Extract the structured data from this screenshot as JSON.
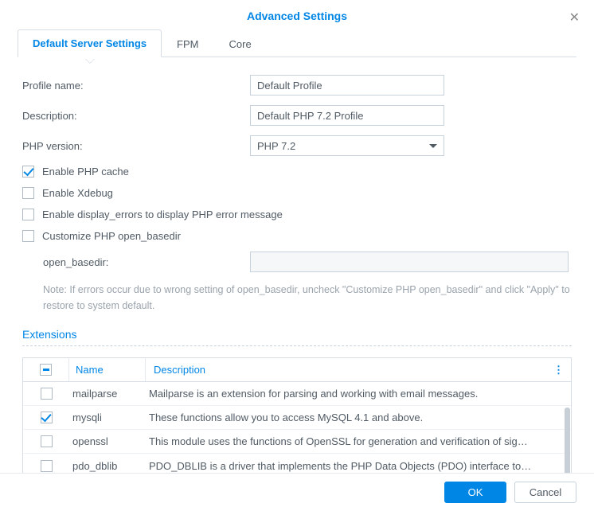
{
  "dialog": {
    "title": "Advanced Settings",
    "close_glyph": "✕"
  },
  "tabs": {
    "default": "Default Server Settings",
    "fpm": "FPM",
    "core": "Core"
  },
  "form": {
    "profile_name_label": "Profile name:",
    "profile_name_value": "Default Profile",
    "description_label": "Description:",
    "description_value": "Default PHP 7.2 Profile",
    "php_version_label": "PHP version:",
    "php_version_value": "PHP 7.2",
    "enable_cache_label": "Enable PHP cache",
    "enable_xdebug_label": "Enable Xdebug",
    "enable_display_errors_label": "Enable display_errors to display PHP error message",
    "customize_basedir_label": "Customize PHP open_basedir",
    "open_basedir_label": "open_basedir:",
    "open_basedir_value": "",
    "note_prefix": "Note:",
    "note_text": " If errors occur due to wrong setting of open_basedir, uncheck \"Customize PHP open_basedir\" and click \"Apply\" to restore to system default."
  },
  "extensions": {
    "section_title": "Extensions",
    "header_name": "Name",
    "header_description": "Description",
    "rows": [
      {
        "checked": false,
        "name": "mailparse",
        "desc": "Mailparse is an extension for parsing and working with email messages."
      },
      {
        "checked": true,
        "name": "mysqli",
        "desc": "These functions allow you to access MySQL 4.1 and above."
      },
      {
        "checked": false,
        "name": "openssl",
        "desc": "This module uses the functions of OpenSSL for generation and verification of sig…"
      },
      {
        "checked": false,
        "name": "pdo_dblib",
        "desc": "PDO_DBLIB is a driver that implements the PHP Data Objects (PDO) interface to…"
      }
    ]
  },
  "footer": {
    "ok": "OK",
    "cancel": "Cancel"
  }
}
